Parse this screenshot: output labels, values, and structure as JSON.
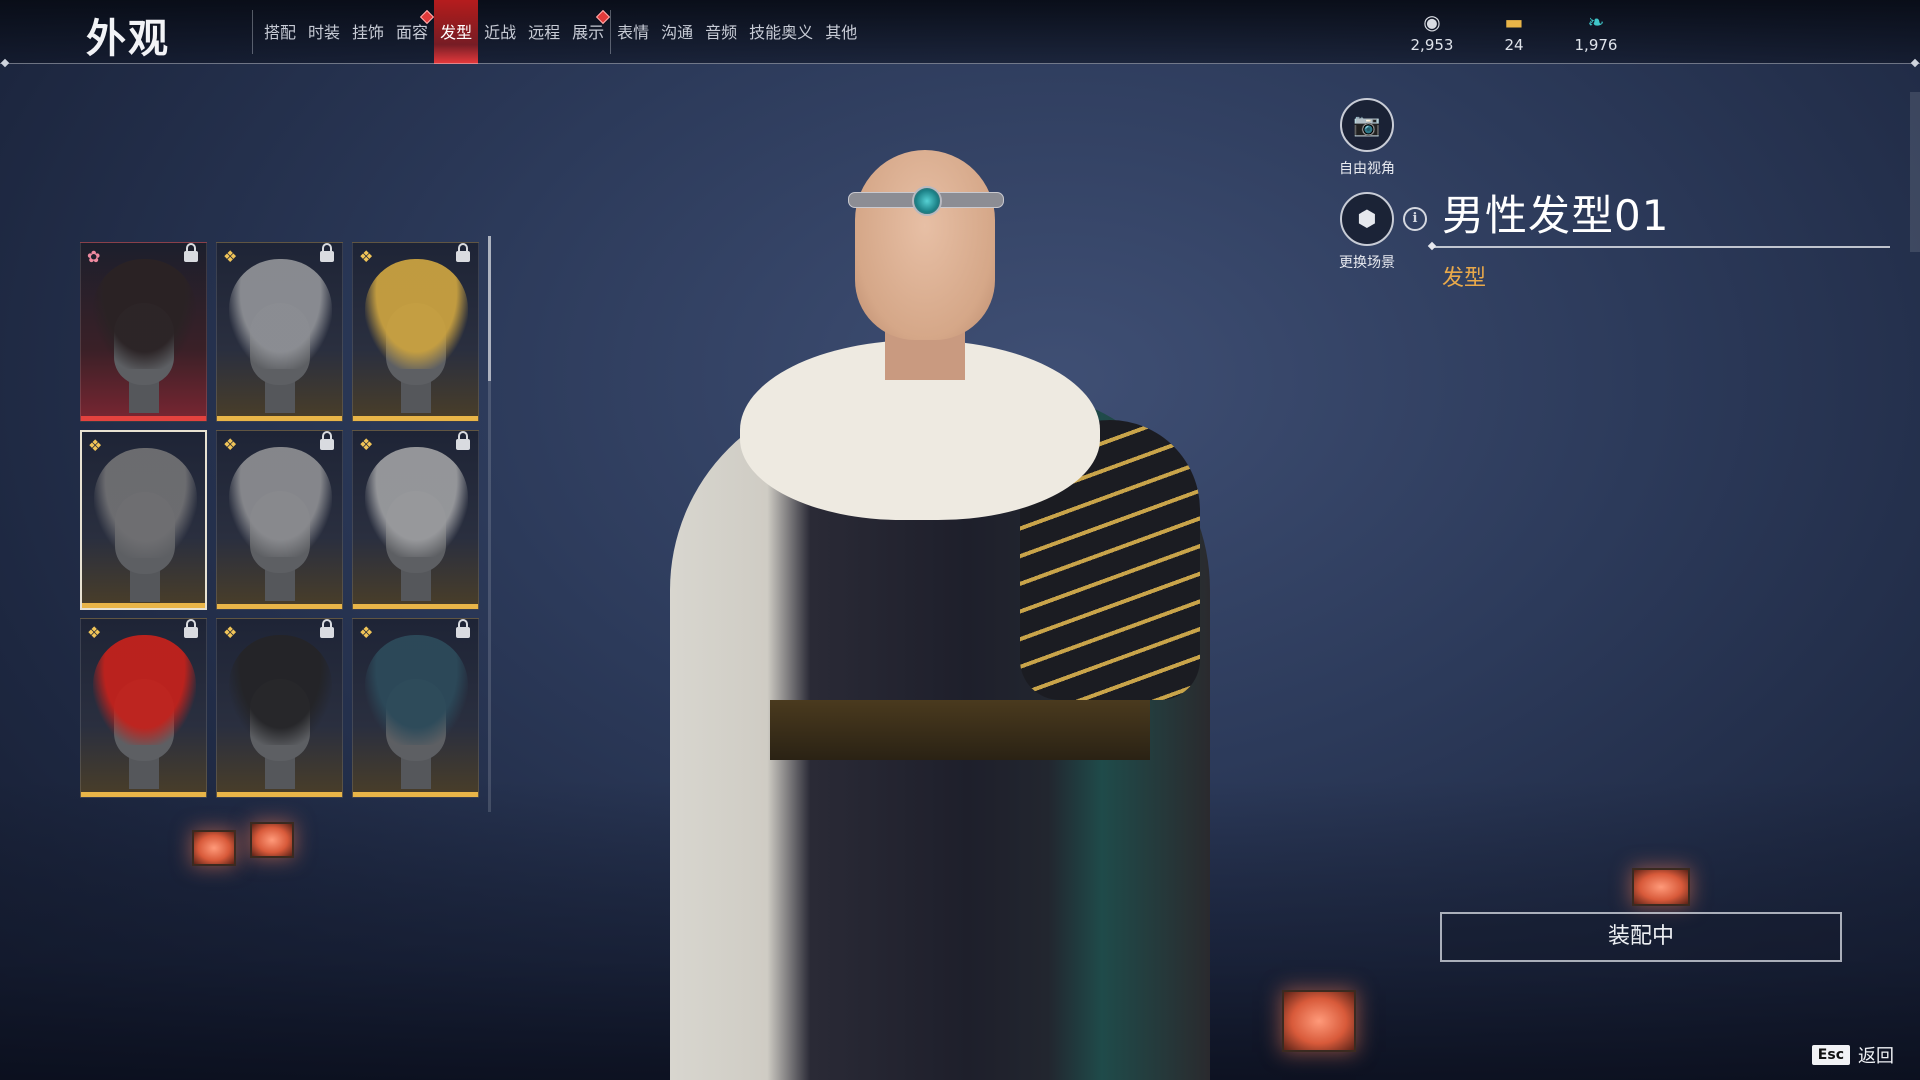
{
  "header": {
    "title": "外观",
    "tabs": [
      {
        "label": "搭配",
        "active": false,
        "badge": false
      },
      {
        "label": "时装",
        "active": false,
        "badge": false
      },
      {
        "label": "挂饰",
        "active": false,
        "badge": false
      },
      {
        "label": "面容",
        "active": false,
        "badge": true
      },
      {
        "label": "发型",
        "active": true,
        "badge": false
      },
      {
        "label": "近战",
        "active": false,
        "badge": false
      },
      {
        "label": "远程",
        "active": false,
        "badge": false
      },
      {
        "label": "展示",
        "active": false,
        "badge": true
      },
      {
        "label": "表情",
        "active": false,
        "badge": false
      },
      {
        "label": "沟通",
        "active": false,
        "badge": false
      },
      {
        "label": "音频",
        "active": false,
        "badge": false
      },
      {
        "label": "技能奥义",
        "active": false,
        "badge": false
      },
      {
        "label": "其他",
        "active": false,
        "badge": false
      }
    ],
    "currencies": [
      {
        "icon": "coin-stack-icon",
        "value": "2,953",
        "color": "#d8dbe2"
      },
      {
        "icon": "ticket-icon",
        "value": "24",
        "color": "#e9b548"
      },
      {
        "icon": "feather-icon",
        "value": "1,976",
        "color": "#3fc6c9"
      }
    ]
  },
  "hairstyles": [
    {
      "rarity": "red",
      "locked": true,
      "selected": false,
      "hair_color": "#2a2224"
    },
    {
      "rarity": "gold",
      "locked": true,
      "selected": false,
      "hair_color": "#8d8f94"
    },
    {
      "rarity": "gold",
      "locked": true,
      "selected": false,
      "hair_color": "#c9a140"
    },
    {
      "rarity": "gold",
      "locked": false,
      "selected": true,
      "hair_color": "#6f6f72"
    },
    {
      "rarity": "gold",
      "locked": true,
      "selected": false,
      "hair_color": "#8a8b8f"
    },
    {
      "rarity": "gold",
      "locked": true,
      "selected": false,
      "hair_color": "#9a9b9e"
    },
    {
      "rarity": "gold",
      "locked": true,
      "selected": false,
      "hair_color": "#c2221c"
    },
    {
      "rarity": "gold",
      "locked": true,
      "selected": false,
      "hair_color": "#242427"
    },
    {
      "rarity": "gold",
      "locked": true,
      "selected": false,
      "hair_color": "#2c4a5a"
    }
  ],
  "side_buttons": {
    "free_view": "自由视角",
    "change_scene": "更换场景"
  },
  "item": {
    "name": "男性发型01",
    "category": "发型"
  },
  "equip_button": "装配中",
  "footer": {
    "key": "Esc",
    "label": "返回"
  }
}
